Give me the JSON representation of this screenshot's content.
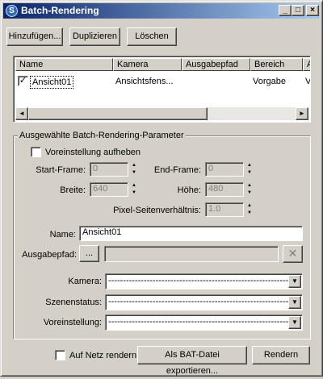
{
  "window": {
    "title": "Batch-Rendering"
  },
  "toolbar": {
    "add_label": "Hinzufügen...",
    "duplicate_label": "Duplizieren",
    "delete_label": "Löschen"
  },
  "list": {
    "columns": [
      "Name",
      "Kamera",
      "Ausgabepfad",
      "Bereich",
      "A"
    ],
    "rows": [
      {
        "checked": true,
        "name": "Ansicht01",
        "camera": "Ansichtsfens...",
        "output": "",
        "range": "Vorgabe",
        "extra": "V"
      }
    ]
  },
  "params": {
    "group_title": "Ausgewählte Batch-Rendering-Parameter",
    "override_label": "Voreinstellung aufheben",
    "start_frame_label": "Start-Frame:",
    "start_frame_value": "0",
    "end_frame_label": "End-Frame:",
    "end_frame_value": "0",
    "width_label": "Breite:",
    "width_value": "640",
    "height_label": "Höhe:",
    "height_value": "480",
    "pixel_aspect_label": "Pixel-Seitenverhältnis:",
    "pixel_aspect_value": "1.0",
    "name_label": "Name:",
    "name_value": "Ansicht01",
    "output_label": "Ausgabepfad:",
    "output_browse_label": "...",
    "output_value": "",
    "camera_label": "Kamera:",
    "camera_value": "-------------------------------------------------------------",
    "scene_state_label": "Szenenstatus:",
    "scene_state_value": "-------------------------------------------------------------",
    "preset_label": "Voreinstellung:",
    "preset_value": "-------------------------------------------------------------"
  },
  "footer": {
    "net_render_label": "Auf Netz rendern",
    "export_label": "Als BAT-Datei exportieren...",
    "render_label": "Rendern"
  }
}
